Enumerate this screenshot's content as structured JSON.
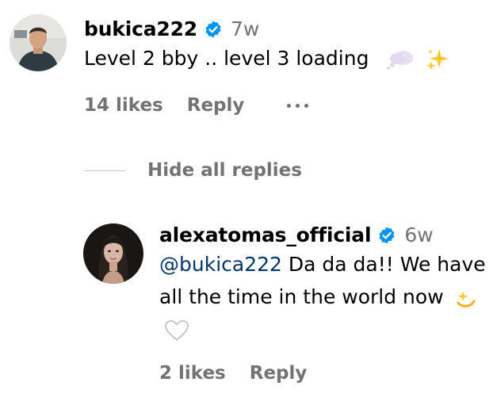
{
  "comments": [
    {
      "username": "bukica222",
      "time": "7w",
      "text": "Level 2 bby .. level 3 loading",
      "emojis": [
        "thought-bubble-emoji",
        "sparkles-emoji"
      ],
      "likes": "14 likes",
      "reply_label": "Reply"
    }
  ],
  "thread": {
    "hide_replies_label": "Hide all replies"
  },
  "replies": [
    {
      "username": "alexatomas_official",
      "time": "6w",
      "mention": "@bukica222",
      "text": "Da da da!! We have all the time in the world now",
      "emojis": [
        "dizzy-emoji",
        "white-heart-emoji"
      ],
      "likes": "2 likes",
      "reply_label": "Reply"
    }
  ],
  "colors": {
    "verified_badge": "#0095f6",
    "secondary_text": "#737373",
    "mention": "#00376b"
  }
}
